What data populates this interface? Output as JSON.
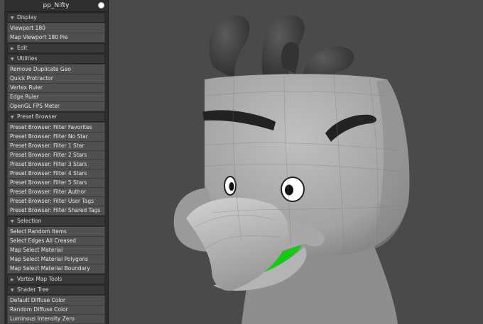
{
  "panel": {
    "title": "pp_Nifty",
    "sections": [
      {
        "label": "Display",
        "expanded": true,
        "items": [
          "Viewport 180",
          "Map Viewport 180 Pie"
        ]
      },
      {
        "label": "Edit",
        "expanded": false,
        "items": []
      },
      {
        "label": "Utilities",
        "expanded": true,
        "items": [
          "Remove Duplicate Geo",
          "Quick Protractor",
          "Vertex Ruler",
          "Edge Ruler",
          "OpenGL FPS Meter"
        ]
      },
      {
        "label": "Preset Browser",
        "expanded": true,
        "items": [
          "Preset Browser: Filter Favorites",
          "Preset Browser: Filter No Star",
          "Preset Browser: Filter 1 Star",
          "Preset Browser: Filter 2 Stars",
          "Preset Browser: Filter 3 Stars",
          "Preset Browser: Filter 4 Stars",
          "Preset Browser: Filter 5 Stars",
          "Preset Browser: Filter Author",
          "Preset Browser: Filter User Tags",
          "Preset Browser: Filter Shared Tags"
        ]
      },
      {
        "label": "Selection",
        "expanded": true,
        "items": [
          "Select Random Items",
          "Select Edges All Creased",
          "Map Select Material",
          "Map Select Material Polygons",
          "Map Select Material Boundary"
        ]
      },
      {
        "label": "Vertex Map Tools",
        "expanded": false,
        "items": []
      },
      {
        "label": "Shader Tree",
        "expanded": true,
        "items": [
          "Default Diffuse Color",
          "Random Diffuse Color",
          "Luminous Intensity Zero"
        ]
      }
    ]
  },
  "colors": {
    "viewport_bg": "#4a4a4a",
    "panel_bg": "#2c2c2c",
    "model_gray": "#a4a4a4",
    "horns": "#3c3c3c",
    "mouth_green": "#18c818",
    "eyebrow": "#222222"
  }
}
